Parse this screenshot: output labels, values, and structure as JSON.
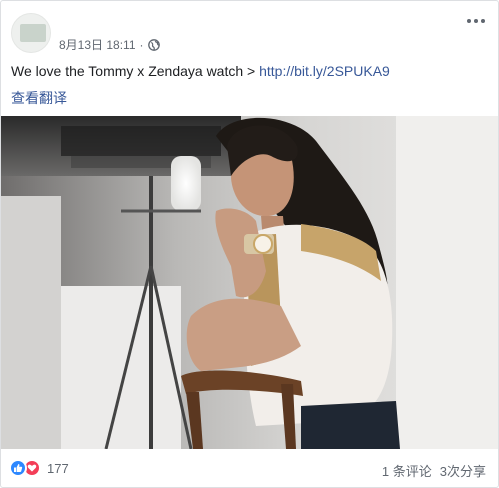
{
  "post": {
    "timestamp": "8月13日 18:11",
    "separator": "·",
    "privacy_icon": "globe-icon",
    "more_icon": "more-options-icon",
    "text": "We love the Tommy x Zendaya watch > ",
    "link_text": "http://bit.ly/2SPUKA9",
    "translate_label": "查看翻译"
  },
  "footer": {
    "reaction_icons": [
      "like-icon",
      "love-icon"
    ],
    "reaction_count": "177",
    "comments": "1 条评论",
    "shares": "3次分享"
  },
  "colors": {
    "link": "#385898",
    "meta": "#606770",
    "like": "#2d88ff",
    "love": "#f33e58"
  }
}
